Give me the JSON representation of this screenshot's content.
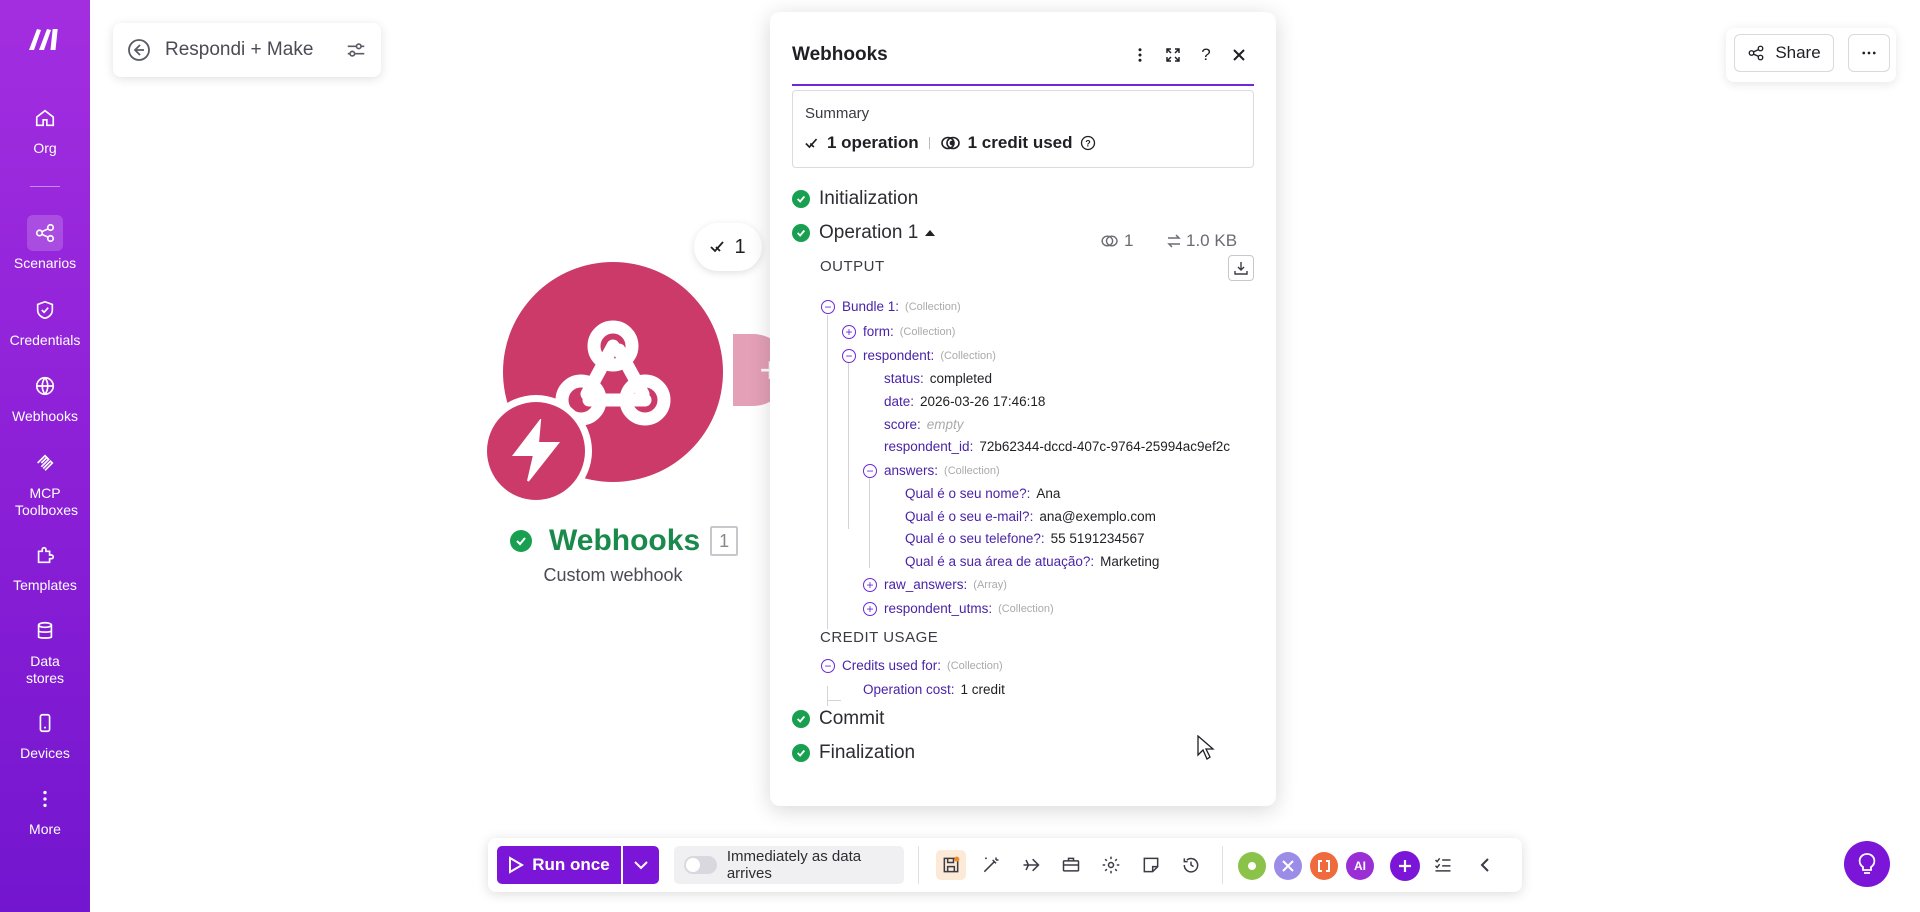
{
  "sidebar": {
    "items": [
      {
        "label": "Org",
        "icon": "home-icon"
      },
      {
        "label": "Scenarios",
        "icon": "share-nodes-icon"
      },
      {
        "label": "Credentials",
        "icon": "shield-check-icon"
      },
      {
        "label": "Webhooks",
        "icon": "globe-icon"
      },
      {
        "label": "MCP Toolboxes",
        "icon": "mcp-icon"
      },
      {
        "label": "Templates",
        "icon": "puzzle-icon"
      },
      {
        "label": "Data stores",
        "icon": "database-icon"
      },
      {
        "label": "Devices",
        "icon": "mobile-icon"
      },
      {
        "label": "More",
        "icon": "dots-vertical-icon"
      }
    ]
  },
  "header": {
    "scenario_name": "Respondi + Make",
    "share_label": "Share"
  },
  "module": {
    "title": "Webhooks",
    "count": "1",
    "subtitle": "Custom webhook",
    "operations_bubble": "1"
  },
  "panel": {
    "title": "Webhooks",
    "summary_label": "Summary",
    "operations": "1 operation",
    "credits": "1 credit used",
    "phases": {
      "initialization": "Initialization",
      "operation": "Operation 1",
      "commit": "Commit",
      "finalization": "Finalization"
    },
    "op_credits": "1",
    "op_size": "1.0 KB",
    "output_label": "OUTPUT",
    "credit_usage_label": "CREDIT USAGE",
    "tree": {
      "bundle": {
        "key": "Bundle 1:",
        "type": "(Collection)"
      },
      "form": {
        "key": "form:",
        "type": "(Collection)"
      },
      "respondent": {
        "key": "respondent:",
        "type": "(Collection)"
      },
      "status": {
        "key": "status:",
        "value": "completed"
      },
      "date": {
        "key": "date:",
        "value": "2026-03-26 17:46:18"
      },
      "score": {
        "key": "score:",
        "value": "empty"
      },
      "respondent_id": {
        "key": "respondent_id:",
        "value": "72b62344-dccd-407c-9764-25994ac9ef2c"
      },
      "answers": {
        "key": "answers:",
        "type": "(Collection)"
      },
      "q_nome": {
        "key": "Qual é o seu nome?:",
        "value": "Ana"
      },
      "q_email": {
        "key": "Qual é o seu e-mail?:",
        "value": "ana@exemplo.com"
      },
      "q_telefone": {
        "key": "Qual é o seu telefone?:",
        "value": "55 5191234567"
      },
      "q_area": {
        "key": "Qual é a sua área de atuação?:",
        "value": "Marketing"
      },
      "raw_answers": {
        "key": "raw_answers:",
        "type": "(Array)"
      },
      "respondent_utms": {
        "key": "respondent_utms:",
        "type": "(Collection)"
      },
      "credits_used": {
        "key": "Credits used for:",
        "type": "(Collection)"
      },
      "operation_cost": {
        "key": "Operation cost:",
        "value": "1 credit"
      }
    }
  },
  "toolbar": {
    "run_once": "Run once",
    "schedule": "Immediately as data arrives",
    "ai_chip": "AI"
  },
  "colors": {
    "brand_purple": "#7b16d8",
    "module_pink": "#cb3a68",
    "success_green": "#18a050"
  }
}
